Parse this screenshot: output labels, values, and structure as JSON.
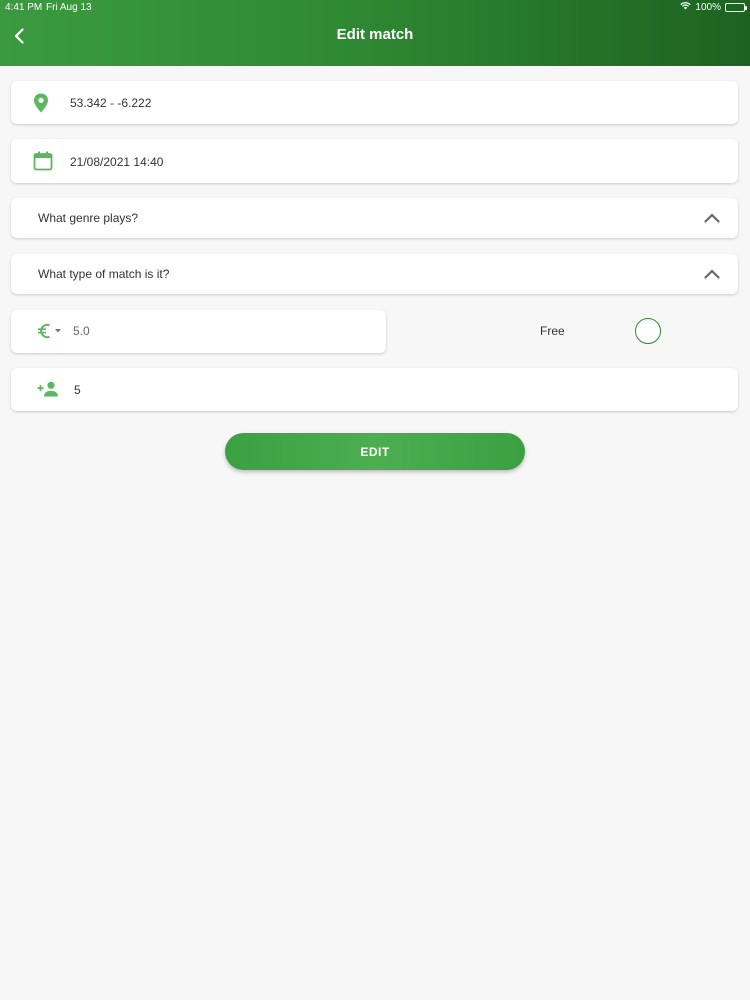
{
  "status_bar": {
    "time": "4:41 PM",
    "date": "Fri Aug 13",
    "battery": "100%"
  },
  "header": {
    "title": "Edit match",
    "back_icon": "chevron-left-icon"
  },
  "form": {
    "location": {
      "icon": "location-pin-icon",
      "value": "53.342 - -6.222"
    },
    "datetime": {
      "icon": "calendar-icon",
      "value": "21/08/2021 14:40"
    },
    "genre": {
      "label": "What genre plays?",
      "icon": "chevron-up-icon"
    },
    "match_type": {
      "label": "What type of match is it?",
      "icon": "chevron-up-icon"
    },
    "price": {
      "currency_icon": "euro-icon",
      "value": "5.0"
    },
    "free": {
      "label": "Free",
      "checked": false
    },
    "players": {
      "icon": "add-person-icon",
      "value": "5"
    }
  },
  "actions": {
    "edit_label": "EDIT"
  },
  "colors": {
    "accent": "#3aa040",
    "header_dark": "#1d6221",
    "icon_green": "#5cb860"
  }
}
